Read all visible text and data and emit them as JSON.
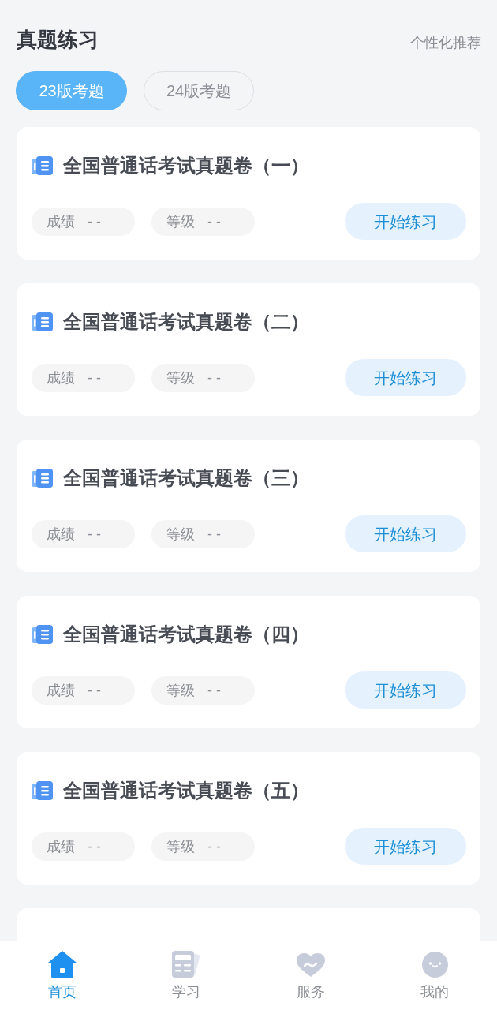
{
  "header": {
    "title": "真题练习",
    "link": "个性化推荐"
  },
  "tabs": [
    {
      "label": "23版考题",
      "selected": true
    },
    {
      "label": "24版考题",
      "selected": false
    }
  ],
  "cards": [
    {
      "title": "全国普通话考试真题卷（一）",
      "stats": [
        {
          "label": "成绩",
          "value": "--"
        },
        {
          "label": "等级",
          "value": "--"
        }
      ],
      "button": "开始练习"
    },
    {
      "title": "全国普通话考试真题卷（二）",
      "stats": [
        {
          "label": "成绩",
          "value": "--"
        },
        {
          "label": "等级",
          "value": "--"
        }
      ],
      "button": "开始练习"
    },
    {
      "title": "全国普通话考试真题卷（三）",
      "stats": [
        {
          "label": "成绩",
          "value": "--"
        },
        {
          "label": "等级",
          "value": "--"
        }
      ],
      "button": "开始练习"
    },
    {
      "title": "全国普通话考试真题卷（四）",
      "stats": [
        {
          "label": "成绩",
          "value": "--"
        },
        {
          "label": "等级",
          "value": "--"
        }
      ],
      "button": "开始练习"
    },
    {
      "title": "全国普通话考试真题卷（五）",
      "stats": [
        {
          "label": "成绩",
          "value": "--"
        },
        {
          "label": "等级",
          "value": "--"
        }
      ],
      "button": "开始练习"
    }
  ],
  "next_card_peek": true,
  "tab_bar": [
    {
      "label": "首页",
      "kind": "home",
      "selected": true
    },
    {
      "label": "学习",
      "kind": "study",
      "selected": false
    },
    {
      "label": "服务",
      "kind": "service",
      "selected": false
    },
    {
      "label": "我的",
      "kind": "profile",
      "selected": false
    }
  ]
}
